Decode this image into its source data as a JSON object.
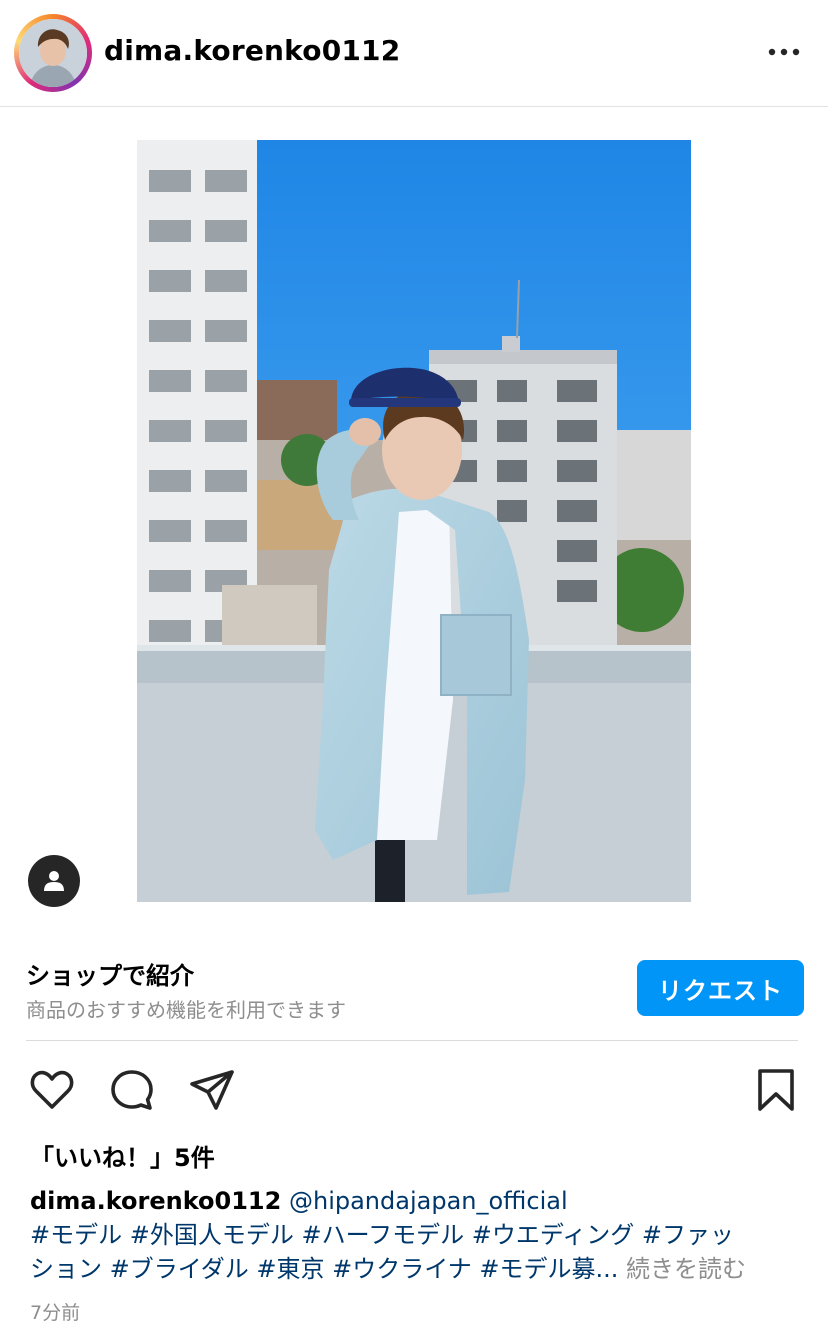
{
  "post": {
    "username": "dima.korenko0112",
    "more_icon": "more-horizontal-icon",
    "tag_icon": "user-tag-icon"
  },
  "shop": {
    "title": "ショップで紹介",
    "subtitle": "商品のおすすめ機能を利用できます",
    "button_label": "リクエスト",
    "button_color": "#0095f6"
  },
  "actions": {
    "like_icon": "heart-icon",
    "comment_icon": "comment-icon",
    "share_icon": "send-icon",
    "save_icon": "bookmark-icon"
  },
  "likes": "「いいね！」5件",
  "caption": {
    "username": "dima.korenko0112",
    "mention": "@hipandajapan_official",
    "line1": "#モデル #外国人モデル #ハーフモデル #ウエディング #ファッ",
    "line2": "ション #ブライダル #東京 #ウクライナ #モデル募...",
    "more": "続きを読む"
  },
  "timestamp": "7分前",
  "colors": {
    "link": "#00376b",
    "muted": "#8e8e8e"
  }
}
